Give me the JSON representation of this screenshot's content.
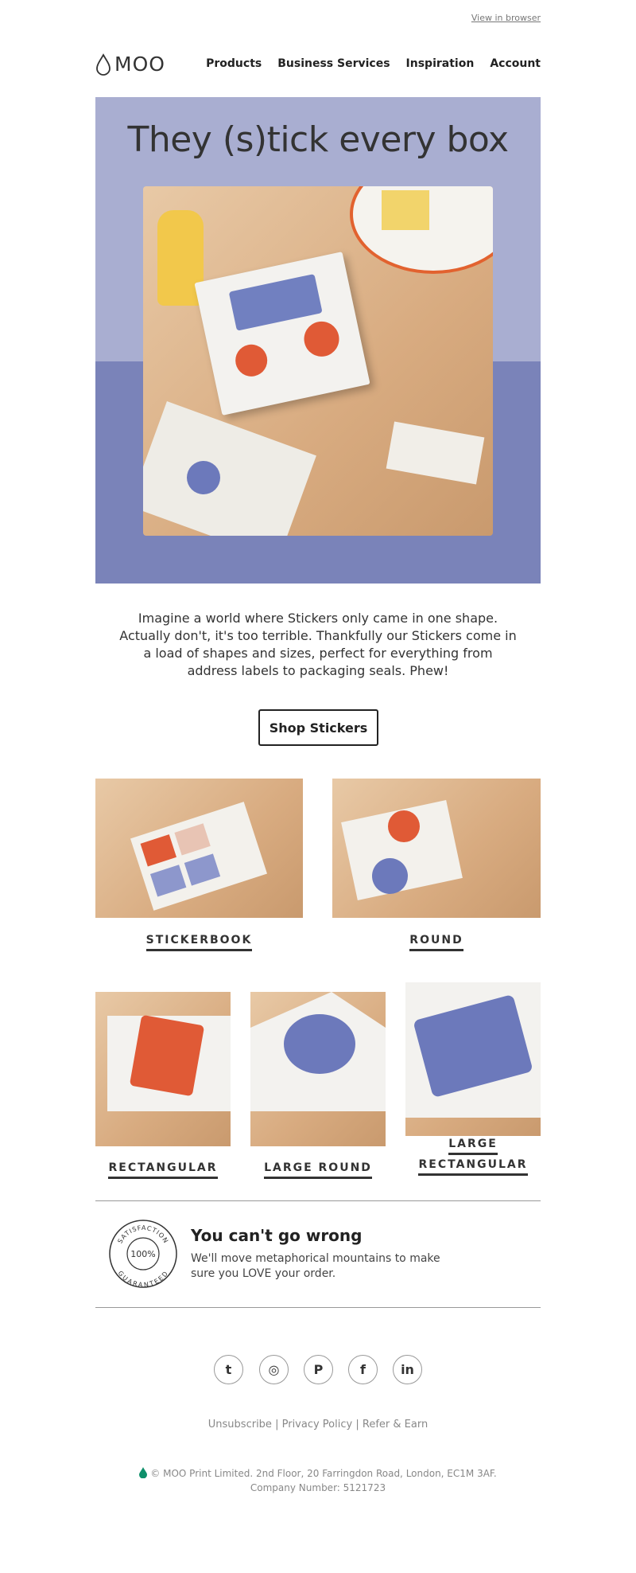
{
  "header": {
    "view_in_browser": "View in browser",
    "logo_text": "MOO",
    "nav": [
      "Products",
      "Business Services",
      "Inspiration",
      "Account"
    ]
  },
  "hero": {
    "title": "They (s)tick every box",
    "colors": {
      "top": "#a9aed1",
      "bottom": "#7a83b9"
    }
  },
  "intro": {
    "text": "Imagine a world where Stickers only came in one shape. Actually don't, it's too terrible. Thankfully our Stickers come in a load of shapes and sizes, perfect for everything from address labels to packaging seals. Phew!",
    "button": "Shop Stickers"
  },
  "products": [
    {
      "label": "STICKERBOOK"
    },
    {
      "label": "ROUND"
    },
    {
      "label": "RECTANGULAR"
    },
    {
      "label": "LARGE ROUND"
    },
    {
      "label_line1": "LARGE",
      "label_line2": "RECTANGULAR"
    }
  ],
  "guarantee": {
    "badge_top": "SATISFACTION",
    "badge_center": "100%",
    "badge_bottom": "GUARANTEED",
    "title": "You can't go wrong",
    "text": "We'll move metaphorical mountains to make sure you LOVE your order."
  },
  "social": [
    {
      "icon": "twitter-icon",
      "glyph": "t"
    },
    {
      "icon": "instagram-icon",
      "glyph": "◎"
    },
    {
      "icon": "pinterest-icon",
      "glyph": "P"
    },
    {
      "icon": "facebook-icon",
      "glyph": "f"
    },
    {
      "icon": "linkedin-icon",
      "glyph": "in"
    }
  ],
  "footer": {
    "links": [
      "Unsubscribe",
      "Privacy Policy",
      "Refer & Earn"
    ],
    "separator": "|",
    "address": "© MOO Print Limited. 2nd Floor, 20 Farringdon Road, London, EC1M 3AF.",
    "company_number": "Company Number: 5121723",
    "drop_color": "#0e8f6a"
  }
}
